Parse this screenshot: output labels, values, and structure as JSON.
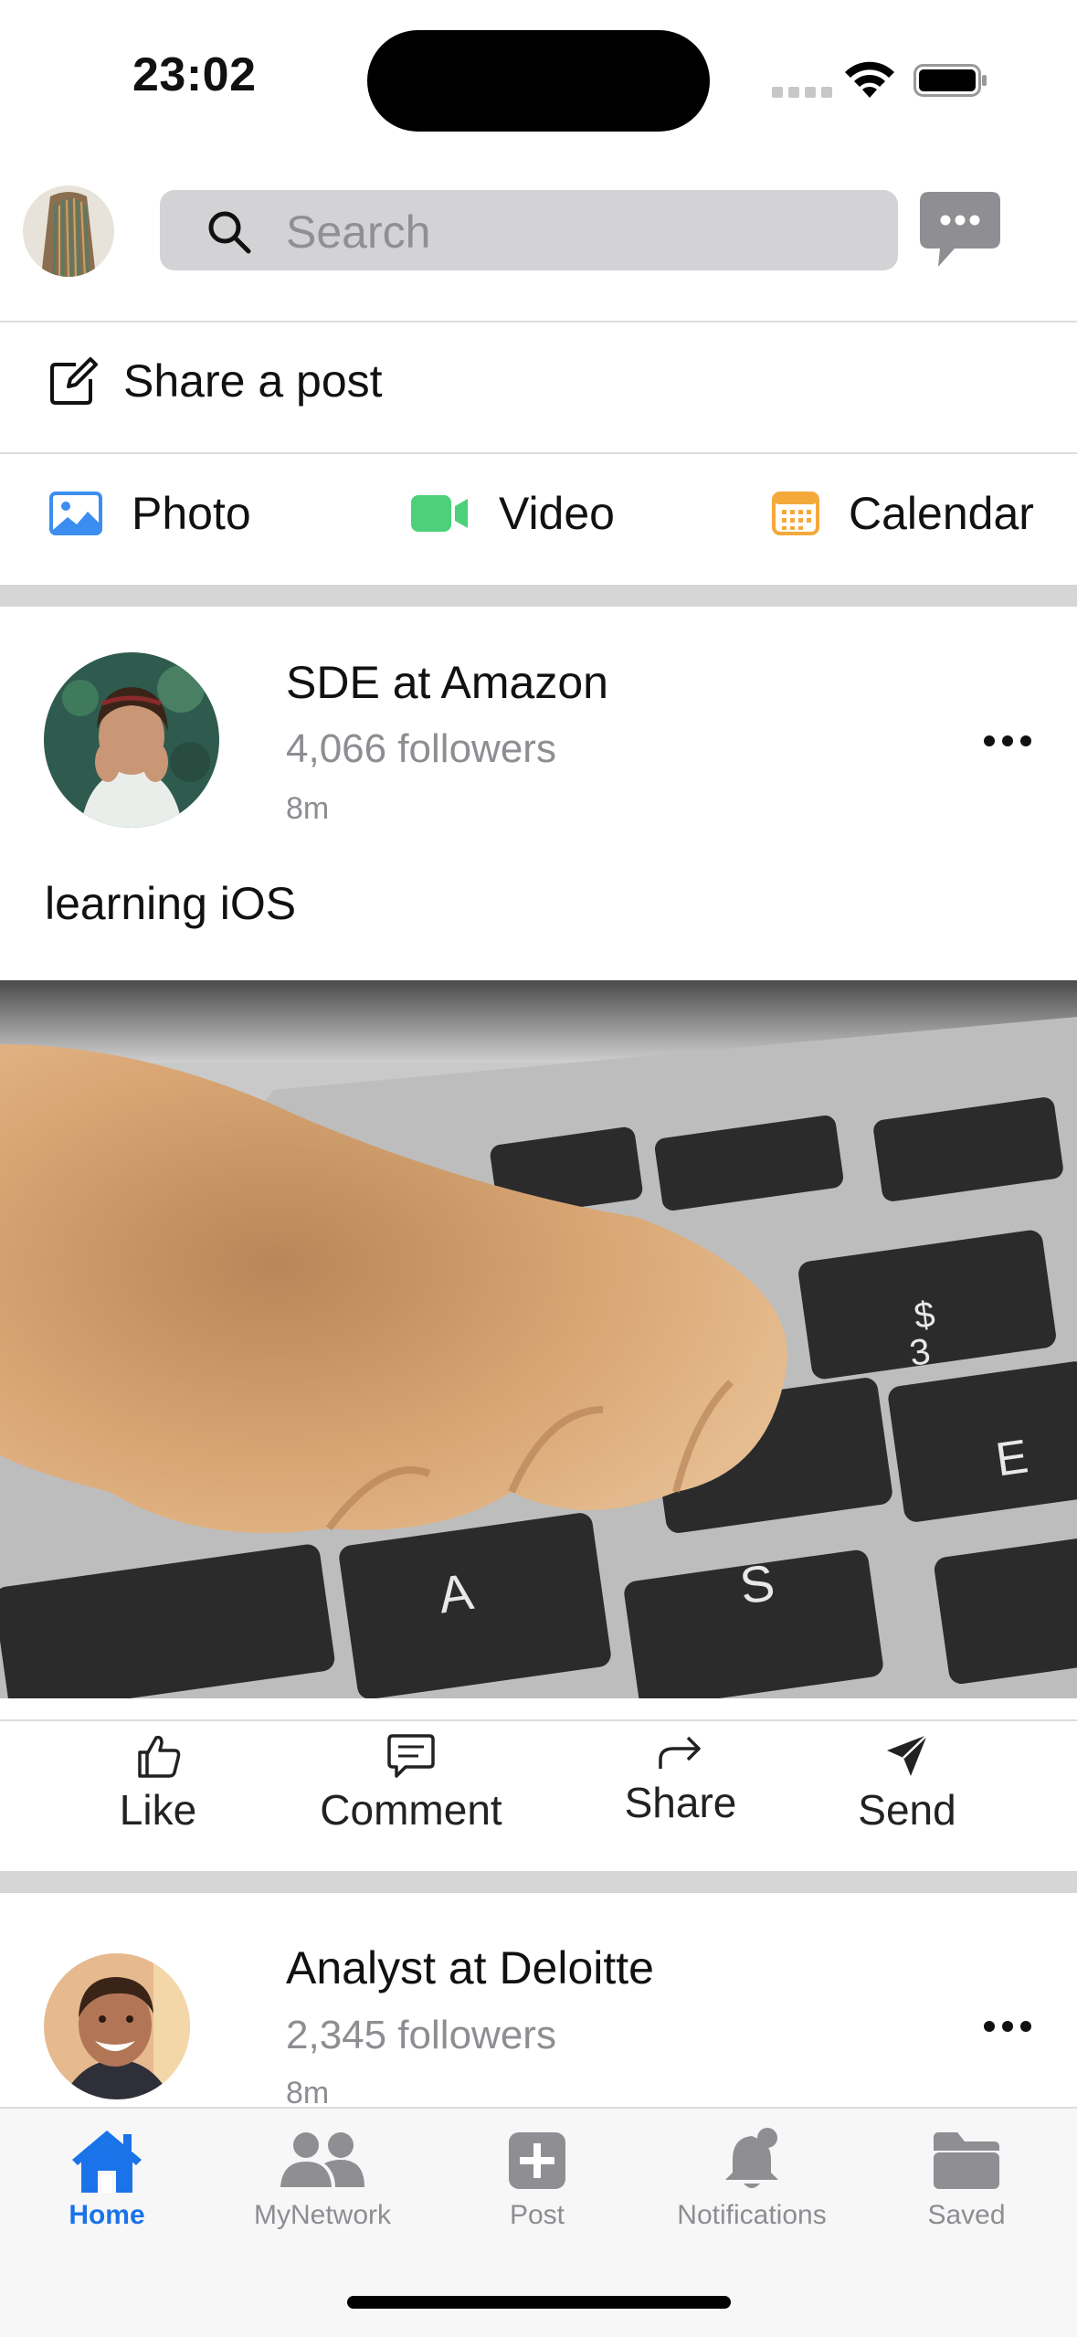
{
  "status_bar": {
    "time": "23:02"
  },
  "header": {
    "search_placeholder": "Search"
  },
  "composer": {
    "share_label": "Share a post",
    "media": [
      {
        "label": "Photo",
        "icon": "photo-icon",
        "color": "#3b8ef0"
      },
      {
        "label": "Video",
        "icon": "video-icon",
        "color": "#4cd07a"
      },
      {
        "label": "Calendar",
        "icon": "calendar-icon",
        "color": "#f4a93b"
      }
    ]
  },
  "posts": [
    {
      "title": "SDE at Amazon",
      "followers": "4,066 followers",
      "time": "8m",
      "text": "learning iOS"
    },
    {
      "title": "Analyst at Deloitte",
      "followers": "2,345 followers",
      "time": "8m"
    }
  ],
  "actions": [
    {
      "label": "Like",
      "icon": "thumbs-up-icon"
    },
    {
      "label": "Comment",
      "icon": "comment-icon"
    },
    {
      "label": "Share",
      "icon": "share-arrow-icon"
    },
    {
      "label": "Send",
      "icon": "paper-plane-icon"
    }
  ],
  "tabs": [
    {
      "label": "Home",
      "icon": "home-icon",
      "active": true
    },
    {
      "label": "MyNetwork",
      "icon": "people-icon"
    },
    {
      "label": "Post",
      "icon": "plus-square-icon"
    },
    {
      "label": "Notifications",
      "icon": "bell-icon"
    },
    {
      "label": "Saved",
      "icon": "folder-icon"
    }
  ],
  "colors": {
    "accent": "#1a73e8",
    "muted": "#8d8d92",
    "separator": "#d6d6d6"
  }
}
